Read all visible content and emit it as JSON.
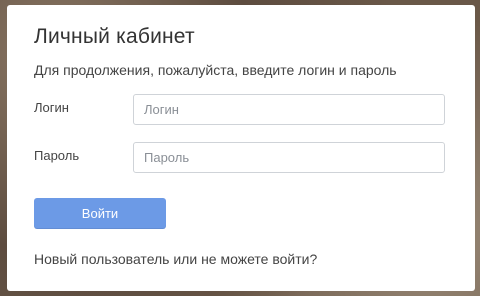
{
  "login_dialog": {
    "title": "Личный кабинет",
    "subtitle": "Для продолжения, пожалуйста, введите логин и пароль",
    "login": {
      "label": "Логин",
      "placeholder": "Логин",
      "value": ""
    },
    "password": {
      "label": "Пароль",
      "placeholder": "Пароль",
      "value": ""
    },
    "submit_label": "Войти",
    "help_link": "Новый пользователь или не можете войти?"
  },
  "colors": {
    "accent": "#6c9ae6",
    "text": "#444444",
    "input_border": "#cfd3d8"
  }
}
